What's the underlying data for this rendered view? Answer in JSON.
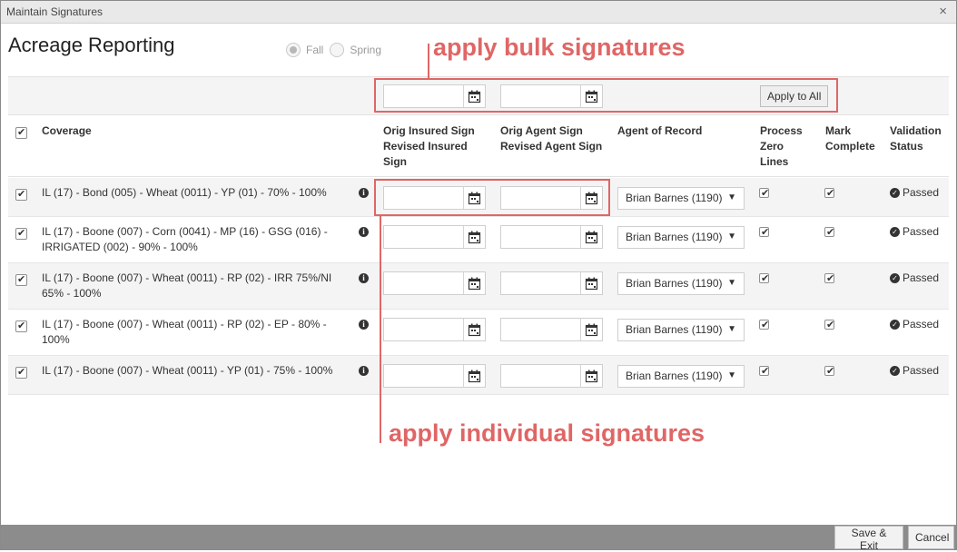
{
  "window": {
    "title": "Maintain Signatures",
    "close_glyph": "×"
  },
  "page_title": "Acreage Reporting",
  "season": {
    "options": [
      "Fall",
      "Spring"
    ],
    "selected": "Fall"
  },
  "bulk": {
    "apply_all_label": "Apply to All"
  },
  "columns": {
    "coverage": "Coverage",
    "insured_sign": [
      "Orig Insured Sign",
      "Revised Insured",
      "Sign"
    ],
    "agent_sign": [
      "Orig Agent Sign",
      "Revised Agent Sign"
    ],
    "agent_of_record": "Agent of Record",
    "process_zero": [
      "Process",
      "Zero",
      "Lines"
    ],
    "mark_complete": [
      "Mark",
      "Complete"
    ],
    "validation_status": [
      "Validation",
      "Status"
    ]
  },
  "rows": [
    {
      "coverage_lines": [
        "IL (17) - Bond (005) - Wheat (0011) - YP (01) - 70% - 100%"
      ],
      "agent": "Brian Barnes (1190)",
      "status": "Passed"
    },
    {
      "coverage_lines": [
        "IL (17) - Boone (007) - Corn (0041) - MP (16) - GSG (016) -",
        "IRRIGATED (002) - 90% - 100%"
      ],
      "agent": "Brian Barnes (1190)",
      "status": "Passed"
    },
    {
      "coverage_lines": [
        "IL (17) - Boone (007) - Wheat (0011) - RP (02) - IRR 75%/NI",
        "65% - 100%"
      ],
      "agent": "Brian Barnes (1190)",
      "status": "Passed"
    },
    {
      "coverage_lines": [
        "IL (17) - Boone (007) - Wheat (0011) - RP (02) - EP - 80% -",
        "100%"
      ],
      "agent": "Brian Barnes (1190)",
      "status": "Passed"
    },
    {
      "coverage_lines": [
        "IL (17) - Boone (007) - Wheat (0011) - YP (01) - 75% - 100%"
      ],
      "agent": "Brian Barnes (1190)",
      "status": "Passed"
    }
  ],
  "annotations": {
    "bulk": "apply bulk signatures",
    "individual": "apply individual signatures"
  },
  "footer": {
    "save_exit_label": "Save & Exit",
    "cancel_label": "Cancel"
  },
  "icons": {
    "calendar": "calendar-icon",
    "info": "info-icon",
    "check_circle": "check-circle-icon",
    "close": "close-icon",
    "dropdown": "chevron-down-icon"
  },
  "colors": {
    "annotation": "#e06666",
    "footer_bar": "#8c8c8c",
    "titlebar": "#e9e9e9"
  }
}
